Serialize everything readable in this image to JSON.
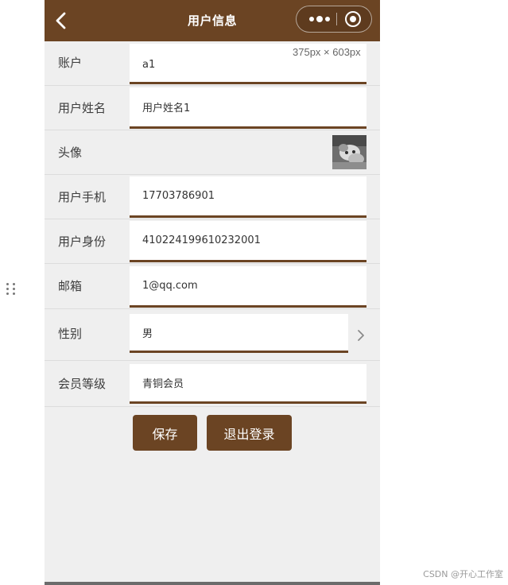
{
  "navbar": {
    "title": "用户信息",
    "back_icon": "chevron-left-icon",
    "more_icon": "more-dots-icon",
    "close_icon": "record-circle-icon"
  },
  "size_hint": "375px × 603px",
  "form": {
    "account": {
      "label": "账户",
      "value": "a1"
    },
    "username": {
      "label": "用户姓名",
      "value": "用户姓名1"
    },
    "avatar": {
      "label": "头像"
    },
    "phone": {
      "label": "用户手机",
      "value": "17703786901"
    },
    "idcard": {
      "label": "用户身份",
      "value": "410224199610232001"
    },
    "email": {
      "label": "邮箱",
      "value": "1@qq.com"
    },
    "gender": {
      "label": "性别",
      "value": "男"
    },
    "member_level": {
      "label": "会员等级",
      "value": "青铜会员"
    }
  },
  "buttons": {
    "save": "保存",
    "logout": "退出登录"
  },
  "watermark": "CSDN @开心工作室",
  "colors": {
    "brand": "#6b4423",
    "page_bg": "#efefef",
    "field_bg": "#ffffff"
  }
}
